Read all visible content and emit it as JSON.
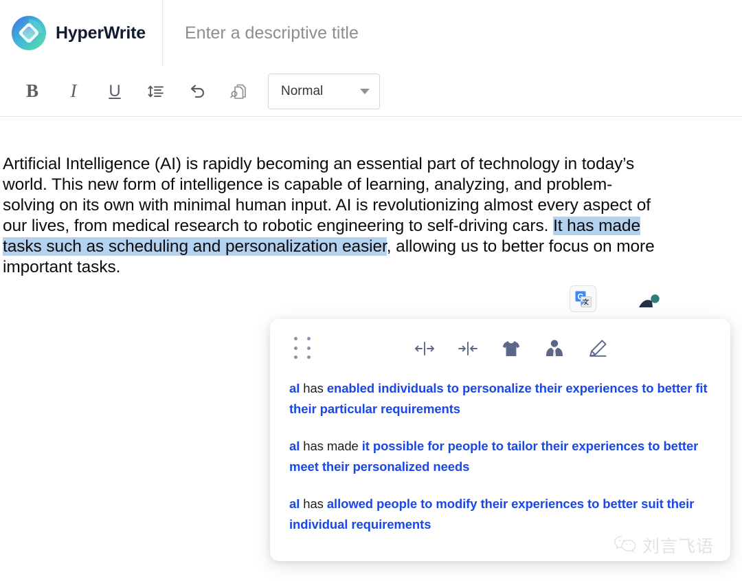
{
  "header": {
    "brand_name": "HyperWrite",
    "logo_icon": "hyperwrite-logo-icon",
    "title_placeholder": "Enter a descriptive title",
    "title_value": ""
  },
  "toolbar": {
    "bold_label": "B",
    "italic_label": "I",
    "underline_label": "U",
    "line_spacing_icon": "line-spacing-icon",
    "undo_icon": "undo-icon",
    "find_in_document_icon": "find-in-document-icon",
    "style_select_value": "Normal",
    "style_select_caret": "chevron-down-icon"
  },
  "document": {
    "paragraph_part_1": "Artificial Intelligence (AI) is rapidly becoming an essential part of technology in today’s world. This new form of intelligence is capable of learning, analyzing, and problem-solving on its own with minimal human input. AI is revolutionizing almost every aspect of our lives, from medical research to robotic engineering to self-driving cars. ",
    "selected_text": "It has made tasks such as scheduling and personalization easier",
    "paragraph_part_2": ", allowing us to better focus on more important tasks.",
    "selection_color": "#b4d1ef"
  },
  "browser_extension": {
    "google_translate_icon": "google-translate-icon",
    "google_translate_letter": "G"
  },
  "cursor": {
    "icon": "mouse-cursor-icon",
    "accent_color": "#2f7d78"
  },
  "popup": {
    "drag_handle_icon": "drag-handle-dots-icon",
    "actions": [
      {
        "name": "expand-button",
        "icon": "expand-horizontal-icon",
        "label": "Expand"
      },
      {
        "name": "shorten-button",
        "icon": "shorten-horizontal-icon",
        "label": "Shorten"
      },
      {
        "name": "casual-tone-button",
        "icon": "tshirt-icon",
        "label": "Casual"
      },
      {
        "name": "formal-tone-button",
        "icon": "person-in-suit-icon",
        "label": "Formal"
      },
      {
        "name": "rewrite-button",
        "icon": "pencil-edit-icon",
        "label": "Rewrite"
      }
    ],
    "suggestions": [
      {
        "lead": "aI",
        "plain": " has ",
        "rest": "enabled individuals to personalize their experiences to better fit their particular requirements"
      },
      {
        "lead": "aI",
        "plain": " has made ",
        "rest": "it possible for people to tailor their experiences to better meet their personalized needs"
      },
      {
        "lead": "aI",
        "plain": " has ",
        "rest": "allowed people to modify their experiences to better suit their individual requirements"
      }
    ],
    "suggestion_color": "#1a47e8"
  },
  "watermark": {
    "icon": "wechat-icon",
    "text": "刘言飞语"
  }
}
